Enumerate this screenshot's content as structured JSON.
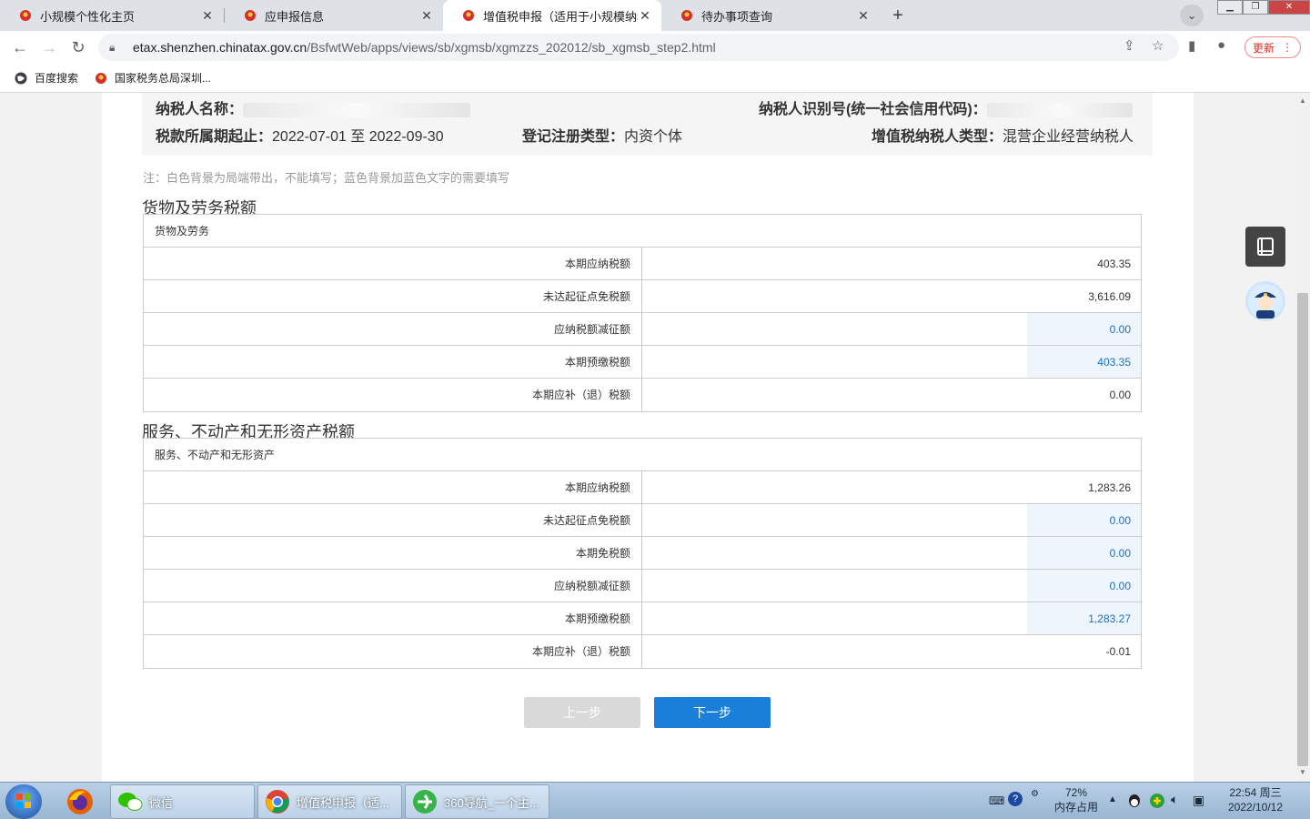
{
  "browser": {
    "tabs": [
      {
        "title": "小规模个性化主页",
        "active": false
      },
      {
        "title": "应申报信息",
        "active": false
      },
      {
        "title": "增值税申报（适用于小规模纳税人",
        "active": true
      },
      {
        "title": "待办事项查询",
        "active": false
      }
    ],
    "new_tab": "+",
    "url_host": "etax.shenzhen.chinatax.gov.cn",
    "url_path": "/BsfwtWeb/apps/views/sb/xgmsb/xgmzzs_202012/sb_xgmsb_step2.html",
    "update_label": "更新"
  },
  "bookmarks": [
    {
      "label": "百度搜索",
      "icon": "globe-icon"
    },
    {
      "label": "国家税务总局深圳...",
      "icon": "tax-emblem-icon"
    }
  ],
  "info": {
    "taxpayer_name_label": "纳税人名称：",
    "taxpayer_id_label": "纳税人识别号(统一社会信用代码)：",
    "period_label": "税款所属期起止：",
    "period_value": "2022-07-01 至 2022-09-30",
    "reg_type_label": "登记注册类型：",
    "reg_type_value": "内资个体",
    "vat_type_label": "增值税纳税人类型：",
    "vat_type_value": "混营企业经营纳税人"
  },
  "note": "注：白色背景为局端带出，不能填写；蓝色背景加蓝色文字的需要填写",
  "goods": {
    "section_title": "货物及劳务税额",
    "table_header": "货物及劳务",
    "rows": [
      {
        "label": "本期应纳税额",
        "value": "403.35",
        "editable": false
      },
      {
        "label": "未达起征点免税额",
        "value": "3,616.09",
        "editable": false
      },
      {
        "label": "应纳税额减征额",
        "value": "0.00",
        "editable": true
      },
      {
        "label": "本期预缴税额",
        "value": "403.35",
        "editable": true
      },
      {
        "label": "本期应补（退）税额",
        "value": "0.00",
        "editable": false
      }
    ]
  },
  "services": {
    "section_title": "服务、不动产和无形资产税额",
    "table_header": "服务、不动产和无形资产",
    "rows": [
      {
        "label": "本期应纳税额",
        "value": "1,283.26",
        "editable": false
      },
      {
        "label": "未达起征点免税额",
        "value": "0.00",
        "editable": true
      },
      {
        "label": "本期免税额",
        "value": "0.00",
        "editable": true
      },
      {
        "label": "应纳税额减征额",
        "value": "0.00",
        "editable": true
      },
      {
        "label": "本期预缴税额",
        "value": "1,283.27",
        "editable": true
      },
      {
        "label": "本期应补（退）税额",
        "value": "-0.01",
        "editable": false
      }
    ]
  },
  "buttons": {
    "prev": "上一步",
    "next": "下一步"
  },
  "taskbar": {
    "apps": [
      {
        "label": "微信",
        "icon": "wechat-icon"
      },
      {
        "label": "增值税申报（适...",
        "icon": "chrome-icon"
      },
      {
        "label": "360导航_一个主...",
        "icon": "ie360-icon"
      }
    ],
    "memory_percent": "72%",
    "memory_label": "内存占用",
    "time": "22:54 周三",
    "date": "2022/10/12"
  }
}
